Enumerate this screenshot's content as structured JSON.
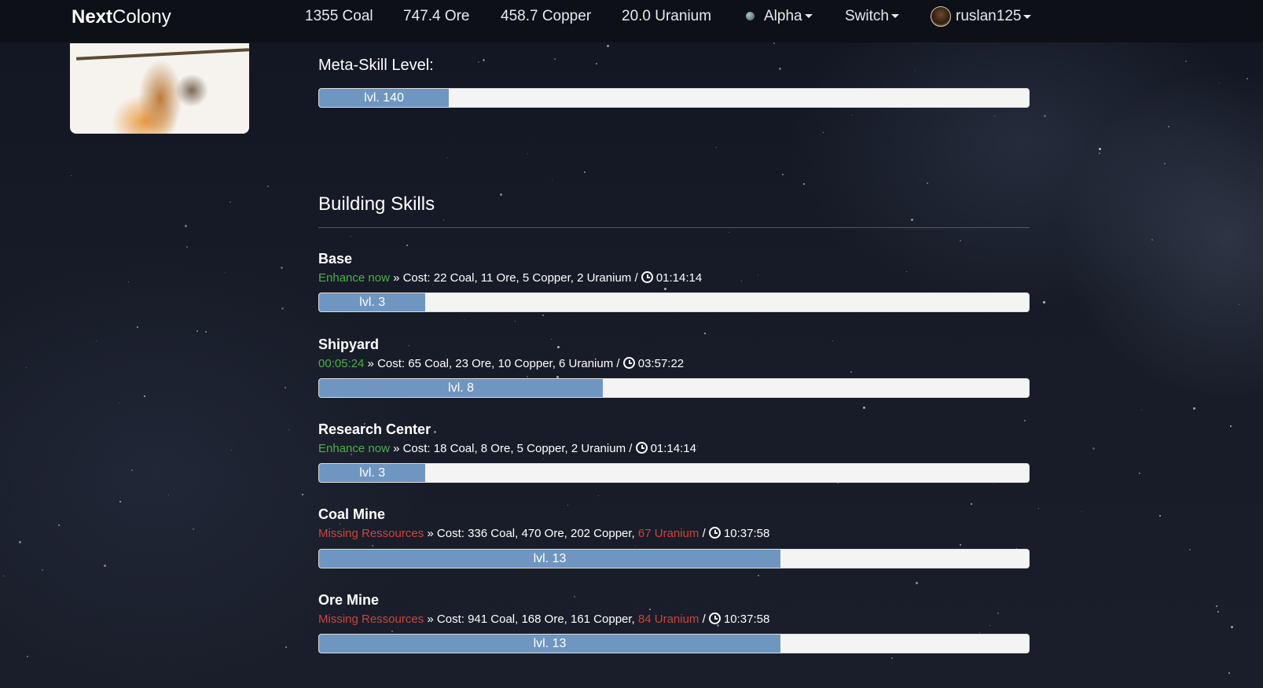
{
  "brand": {
    "bold": "Next",
    "rest": "Colony"
  },
  "resources": {
    "coal": "1355 Coal",
    "ore": "747.4 Ore",
    "copper": "458.7 Copper",
    "uranium": "20.0 Uranium"
  },
  "nav": {
    "planet": "Alpha",
    "switch": "Switch",
    "user": "ruslan125"
  },
  "meta_skill": {
    "label": "Meta-Skill Level:",
    "level_label": "lvl. 140",
    "progress": 0.183
  },
  "section_title": "Building Skills",
  "skills": [
    {
      "name": "Base",
      "status": "Enhance now",
      "sep": " » Cost: ",
      "cost_text": "22 Coal, 11 Ore, 5 Copper, 2 Uranium",
      "slash": " / ",
      "time": "01:14:14",
      "level_label": "lvl. 3",
      "progress": 0.15
    },
    {
      "name": "Shipyard",
      "status": "00:05:24",
      "sep": " » Cost: ",
      "cost_text": "65 Coal, 23 Ore, 10 Copper, 6 Uranium",
      "slash": " / ",
      "time": "03:57:22",
      "level_label": "lvl. 8",
      "progress": 0.4
    },
    {
      "name": "Research Center",
      "status": "Enhance now",
      "sep": " » Cost: ",
      "cost_text": "18 Coal, 8 Ore, 5 Copper, 2 Uranium",
      "slash": " / ",
      "time": "01:14:14",
      "level_label": "lvl. 3",
      "progress": 0.15
    },
    {
      "name": "Coal Mine",
      "status": "Missing Ressources",
      "sep": " » Cost: ",
      "cost_text": "336 Coal, 470 Ore, 202 Copper, ",
      "missing": "67 Uranium",
      "slash": " / ",
      "time": "10:37:58",
      "level_label": "lvl. 13",
      "progress": 0.65
    },
    {
      "name": "Ore Mine",
      "status": "Missing Ressources",
      "sep": " » Cost: ",
      "cost_text": "941 Coal, 168 Ore, 161 Copper, ",
      "missing": "84 Uranium",
      "slash": " / ",
      "time": "10:37:58",
      "level_label": "lvl. 13",
      "progress": 0.65
    }
  ],
  "colors": {
    "green": "#4cae4c",
    "red": "#c9453f",
    "bar_fill": "#6e96c0"
  }
}
